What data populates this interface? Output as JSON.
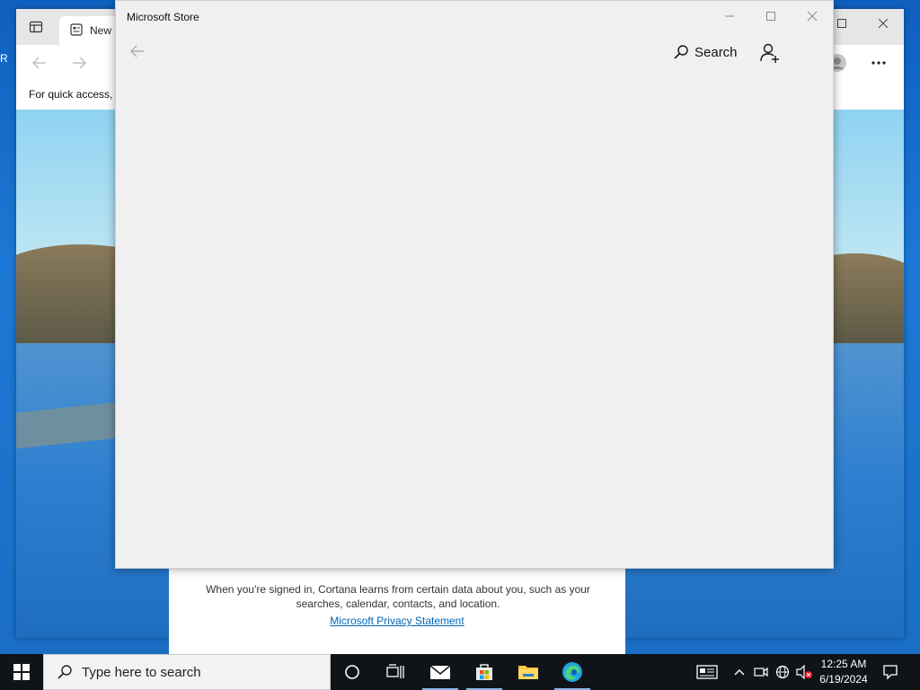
{
  "edge": {
    "tab_title": "New",
    "quick_access_text": "For quick access, p"
  },
  "store": {
    "title": "Microsoft Store",
    "search_label": "Search"
  },
  "cortana": {
    "info_text": "When you're signed in, Cortana learns from certain data about you, such as your searches, calendar, contacts, and location.",
    "privacy_link": "Microsoft Privacy Statement"
  },
  "taskbar": {
    "search_placeholder": "Type here to search",
    "time": "12:25 AM",
    "date": "6/19/2024"
  },
  "colors": {
    "taskbar_bg": "#101418",
    "store_bg": "#f0f0f0",
    "link": "#0067b8"
  }
}
